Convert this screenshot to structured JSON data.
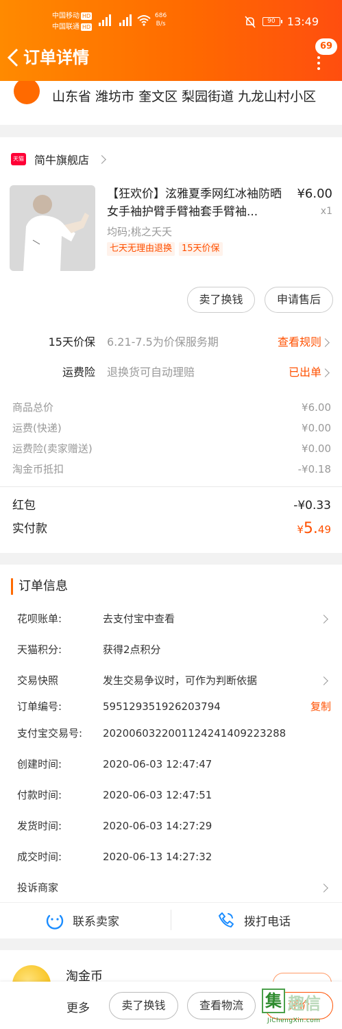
{
  "status_bar": {
    "carrier_1": "中国移动",
    "carrier_2": "中国联通",
    "hd": "HD",
    "net_speed": "686",
    "net_unit": "B/s",
    "battery": "90",
    "time": "13:49"
  },
  "header": {
    "title": "订单详情",
    "message_count": "69"
  },
  "address": {
    "text": "山东省 潍坊市 奎文区 梨园街道 九龙山村小区"
  },
  "shop": {
    "badge": "天猫",
    "name": "简牛旗舰店"
  },
  "product": {
    "title": "【狂欢价】泫雅夏季网红冰袖防晒女手袖护臂手臂袖套手臂袖...",
    "price": "¥6.00",
    "quantity": "x1",
    "spec": "均码;桃之夭夭",
    "tags": [
      "七天无理由退换",
      "15天价保"
    ]
  },
  "item_actions": {
    "sell_label": "卖了换钱",
    "after_sale_label": "申请售后"
  },
  "services": [
    {
      "label": "15天价保",
      "desc": "6.21-7.5为价保服务期",
      "link": "查看规则"
    },
    {
      "label": "运费险",
      "desc": "退换货可自动理赔",
      "link": "已出单"
    }
  ],
  "costs": [
    {
      "label": "商品总价",
      "value": "¥6.00"
    },
    {
      "label": "运费(快递)",
      "value": "¥0.00"
    },
    {
      "label": "运费险(卖家赠送)",
      "value": "¥0.00"
    },
    {
      "label": "淘金币抵扣",
      "value": "-¥0.18"
    }
  ],
  "summary": {
    "red_packet_label": "红包",
    "red_packet_value": "-¥0.33",
    "paid_label": "实付款",
    "paid_currency": "¥",
    "paid_int": "5.",
    "paid_dec": "49"
  },
  "order_info": {
    "title": "订单信息",
    "rows": [
      {
        "label": "花呗账单:",
        "value": "去支付宝中查看"
      },
      {
        "label": "天猫积分:",
        "value": "获得2点积分"
      },
      {
        "label": "交易快照",
        "value": "发生交易争议时，可作为判断依据"
      },
      {
        "label": "订单编号:",
        "value": "595129351926203794",
        "action": "复制"
      },
      {
        "label": "支付宝交易号:",
        "value": "2020060322001124241409223288"
      },
      {
        "label": "创建时间:",
        "value": "2020-06-03 12:47:47"
      },
      {
        "label": "付款时间:",
        "value": "2020-06-03 12:47:51"
      },
      {
        "label": "发货时间:",
        "value": "2020-06-03 14:27:29"
      },
      {
        "label": "成交时间:",
        "value": "2020-06-13 14:27:32"
      },
      {
        "label": "投诉商家",
        "value": ""
      }
    ]
  },
  "contact": {
    "seller_label": "联系卖家",
    "phone_label": "拨打电话"
  },
  "coin": {
    "title": "淘金币"
  },
  "bottom_bar": {
    "more_label": "更多",
    "sell_label": "卖了换钱",
    "logistics_label": "查看物流",
    "review_label": "评价"
  },
  "watermark": {
    "char": "集",
    "text": "趣信",
    "url": "JiChengXin.com"
  },
  "colors": {
    "brand_orange": "#ff6a00",
    "price_orange": "#ff5000",
    "tmall_red": "#ff0036"
  }
}
